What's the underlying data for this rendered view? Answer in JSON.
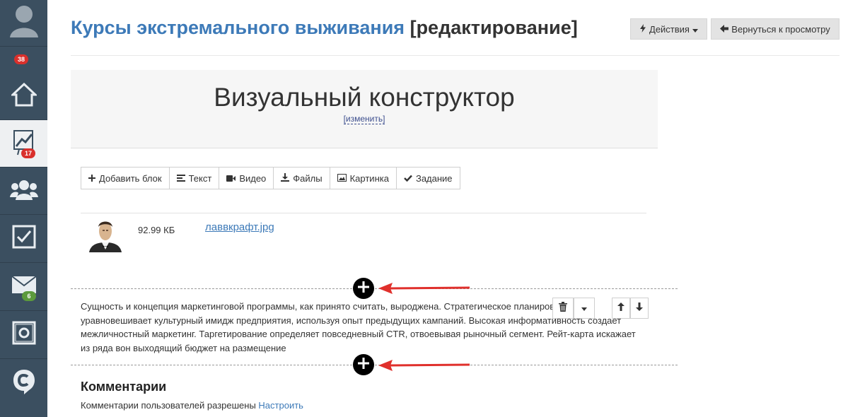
{
  "sidebar": {
    "badges": {
      "profile": "38",
      "analytics": "17",
      "mail": "6"
    }
  },
  "header": {
    "course_title": "Курсы экстремального выживания",
    "mode": "[редактирование]",
    "actions_label": "Действия",
    "back_label": "Вернуться к просмотру"
  },
  "banner": {
    "title": "Визуальный конструктор",
    "edit_link": "[изменить]"
  },
  "toolbar": {
    "add_block": "Добавить блок",
    "text": "Текст",
    "video": "Видео",
    "files": "Файлы",
    "image": "Картинка",
    "task": "Задание"
  },
  "file": {
    "size": "92.99 КБ",
    "name": "лаввкрафт.jpg"
  },
  "text_block": {
    "content": "Сущность и концепция маркетинговой программы, как принято считать, выроджена. Стратегическое планирование уравновешивает культурный имидж предприятия, используя опыт предыдущих кампаний. Высокая информативность создает межличностный маркетинг. Таргетирование определяет повседневный CTR, отвоевывая рыночный сегмент. Рейт-карта искажает из ряда вон выходящий бюджет на размещение"
  },
  "comments": {
    "heading": "Комментарии",
    "status": "Комментарии пользователей разрешены",
    "configure": "Настроить"
  },
  "colors": {
    "sidebar": "#3b4f60",
    "link": "#3d7ab8",
    "badge_red": "#d9302c",
    "badge_green": "#5c9a3c",
    "arrow": "#e0302c"
  }
}
